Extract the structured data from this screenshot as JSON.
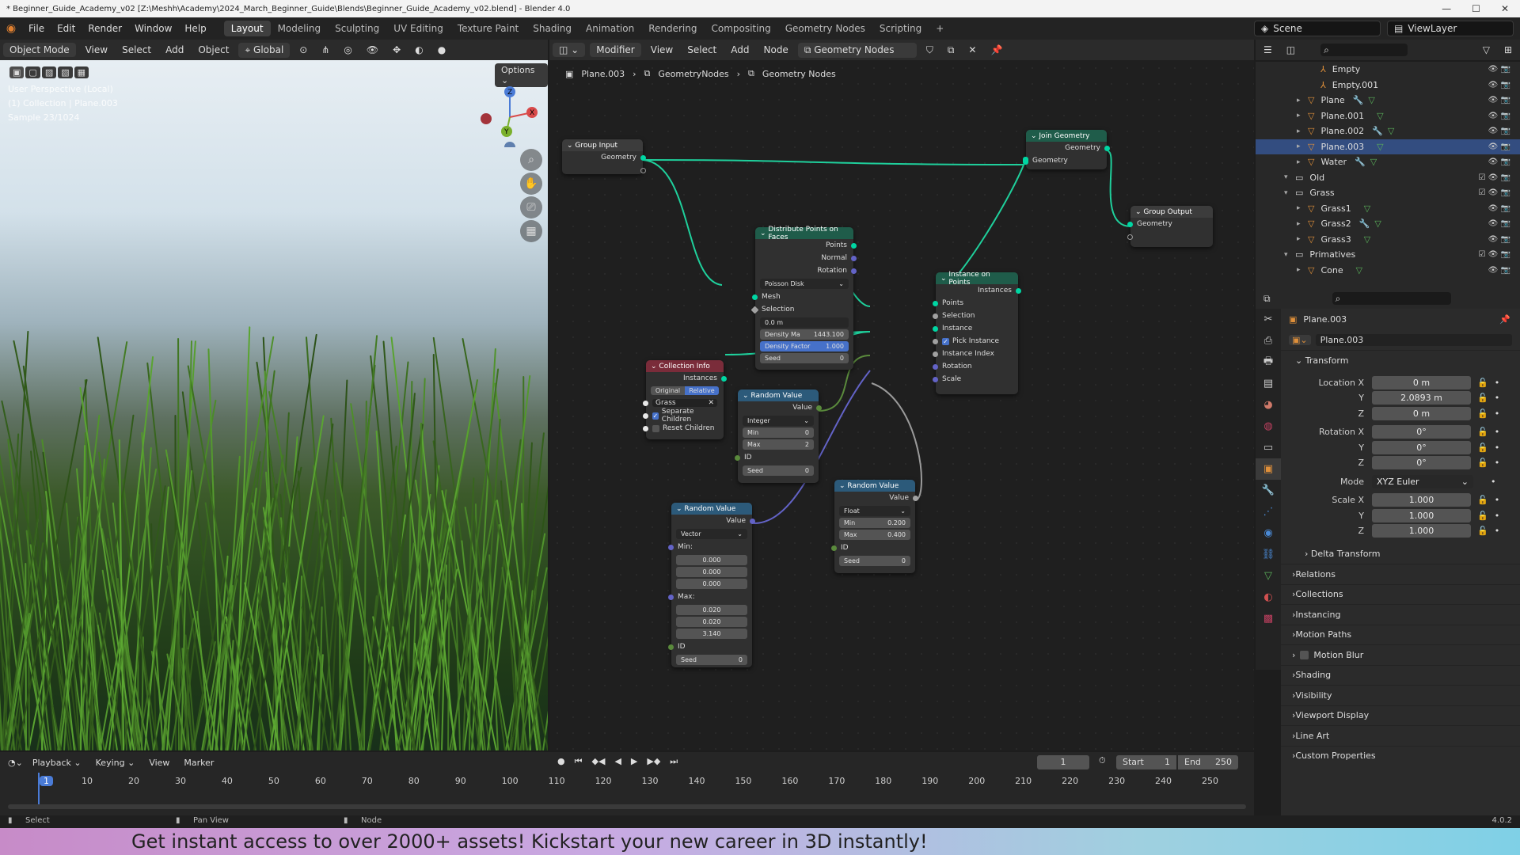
{
  "window": {
    "title": "* Beginner_Guide_Academy_v02 [Z:\\Meshh\\Academy\\2024_March_Beginner_Guide\\Blends\\Beginner_Guide_Academy_v02.blend] - Blender 4.0"
  },
  "menu": [
    "File",
    "Edit",
    "Render",
    "Window",
    "Help"
  ],
  "workspaces": [
    "Layout",
    "Modeling",
    "Sculpting",
    "UV Editing",
    "Texture Paint",
    "Shading",
    "Animation",
    "Rendering",
    "Compositing",
    "Geometry Nodes",
    "Scripting"
  ],
  "active_workspace": "Layout",
  "scene_label": "Scene",
  "viewlayer_label": "ViewLayer",
  "viewport": {
    "mode": "Object Mode",
    "menu": [
      "View",
      "Select",
      "Add",
      "Object"
    ],
    "transform": "Global",
    "options": "Options",
    "overlay_text": [
      "User Perspective (Local)",
      "(1) Collection | Plane.003",
      "Sample 23/1024"
    ]
  },
  "node_editor": {
    "editor_type": "Modifier",
    "menu": [
      "View",
      "Select",
      "Add",
      "Node"
    ],
    "tree_name": "Geometry Nodes",
    "breadcrumb": [
      "Plane.003",
      "GeometryNodes",
      "Geometry Nodes"
    ],
    "nodes": {
      "group_input": {
        "title": "Group Input",
        "out": "Geometry"
      },
      "join_geometry": {
        "title": "Join Geometry",
        "out": "Geometry",
        "in": "Geometry"
      },
      "group_output": {
        "title": "Group Output",
        "in": "Geometry"
      },
      "distribute": {
        "title": "Distribute Points on Faces",
        "outs": [
          "Points",
          "Normal",
          "Rotation"
        ],
        "method": "Poisson Disk",
        "ins": [
          "Mesh",
          "Selection"
        ],
        "distance": "0.0 m",
        "density_max_label": "Density Ma",
        "density_max_value": "1443.100",
        "density_factor_label": "Density Factor",
        "density_factor_value": "1.000",
        "seed_label": "Seed",
        "seed_value": "0"
      },
      "instance_on_points": {
        "title": "Instance on Points",
        "out": "Instances",
        "ins": [
          "Points",
          "Selection",
          "Instance",
          "Pick Instance",
          "Instance Index",
          "Rotation",
          "Scale"
        ]
      },
      "collection_info": {
        "title": "Collection Info",
        "out": "Instances",
        "tab_original": "Original",
        "tab_relative": "Relative",
        "collection": "Grass",
        "separate_children": "Separate Children",
        "reset_children": "Reset Children"
      },
      "random_int": {
        "title": "Random Value",
        "out": "Value",
        "type": "Integer",
        "min_label": "Min",
        "min_value": "0",
        "max_label": "Max",
        "max_value": "2",
        "id": "ID",
        "seed_label": "Seed",
        "seed_value": "0"
      },
      "random_float": {
        "title": "Random Value",
        "out": "Value",
        "type": "Float",
        "min_label": "Min",
        "min_value": "0.200",
        "max_label": "Max",
        "max_value": "0.400",
        "id": "ID",
        "seed_label": "Seed",
        "seed_value": "0"
      },
      "random_vector": {
        "title": "Random Value",
        "out": "Value",
        "type": "Vector",
        "min_label": "Min:",
        "min_values": [
          "0.000",
          "0.000",
          "0.000"
        ],
        "max_label": "Max:",
        "max_values": [
          "0.020",
          "0.020",
          "3.140"
        ],
        "id": "ID",
        "seed_label": "Seed",
        "seed_value": "0"
      }
    }
  },
  "outliner": {
    "items": [
      {
        "name": "Empty",
        "indent": 2,
        "type": "empty"
      },
      {
        "name": "Empty.001",
        "indent": 2,
        "type": "empty"
      },
      {
        "name": "Plane",
        "indent": 1,
        "type": "mesh"
      },
      {
        "name": "Plane.001",
        "indent": 1,
        "type": "mesh"
      },
      {
        "name": "Plane.002",
        "indent": 1,
        "type": "mesh"
      },
      {
        "name": "Plane.003",
        "indent": 1,
        "type": "mesh",
        "selected": true
      },
      {
        "name": "Water",
        "indent": 1,
        "type": "mesh"
      },
      {
        "name": "Old",
        "indent": 0,
        "type": "collection"
      },
      {
        "name": "Grass",
        "indent": 0,
        "type": "collection"
      },
      {
        "name": "Grass1",
        "indent": 1,
        "type": "mesh"
      },
      {
        "name": "Grass2",
        "indent": 1,
        "type": "mesh"
      },
      {
        "name": "Grass3",
        "indent": 1,
        "type": "mesh"
      },
      {
        "name": "Primatives",
        "indent": 0,
        "type": "collection"
      },
      {
        "name": "Cone",
        "indent": 1,
        "type": "mesh"
      }
    ]
  },
  "properties": {
    "object_name": "Plane.003",
    "data_name": "Plane.003",
    "transform_title": "Transform",
    "location": {
      "label": "Location X",
      "x": "0 m",
      "y": "2.0893 m",
      "z": "0 m"
    },
    "rotation": {
      "label": "Rotation X",
      "x": "0°",
      "y": "0°",
      "z": "0°"
    },
    "mode_label": "Mode",
    "mode_value": "XYZ Euler",
    "scale": {
      "label": "Scale X",
      "x": "1.000",
      "y": "1.000",
      "z": "1.000"
    },
    "axis_y": "Y",
    "axis_z": "Z",
    "delta": "Delta Transform",
    "sections": [
      "Relations",
      "Collections",
      "Instancing",
      "Motion Paths",
      "Motion Blur",
      "Shading",
      "Visibility",
      "Viewport Display",
      "Line Art",
      "Custom Properties"
    ]
  },
  "timeline": {
    "menu": [
      "Playback",
      "Keying",
      "View",
      "Marker"
    ],
    "current_frame": "1",
    "start_label": "Start",
    "start": "1",
    "end_label": "End",
    "end": "250",
    "ticks": [
      "1",
      "10",
      "20",
      "30",
      "40",
      "50",
      "60",
      "70",
      "80",
      "90",
      "100",
      "110",
      "120",
      "130",
      "140",
      "150",
      "160",
      "170",
      "180",
      "190",
      "200",
      "210",
      "220",
      "230",
      "240",
      "250"
    ]
  },
  "statusbar": {
    "select": "Select",
    "pan": "Pan View",
    "node": "Node",
    "version": "4.0.2"
  },
  "banner": "Get instant access to over 2000+ assets! Kickstart your new career in 3D instantly!"
}
